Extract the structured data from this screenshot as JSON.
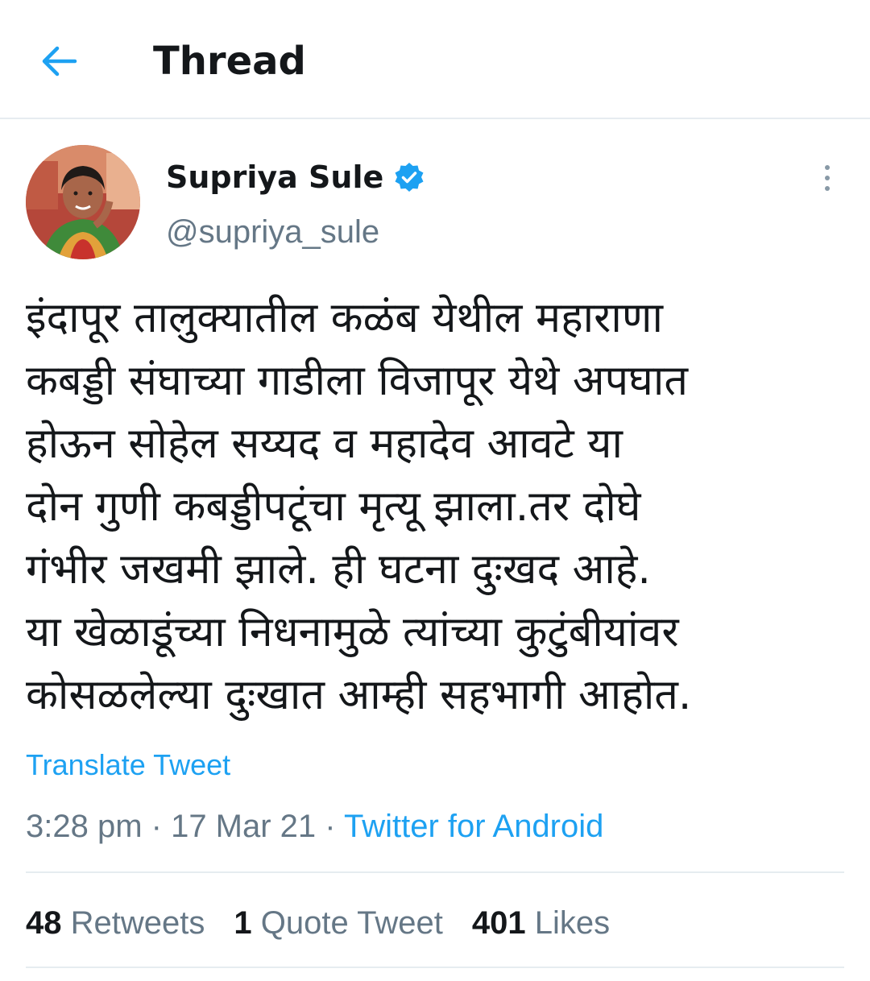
{
  "header": {
    "title": "Thread"
  },
  "author": {
    "name": "Supriya Sule",
    "handle": "@supriya_sule",
    "verified": true
  },
  "tweet": {
    "lines": [
      "इंदापूर तालुक्यातील कळंब येथील महाराणा",
      "कबड्डी संघाच्या गाडीला विजापूर येथे अपघात",
      "होऊन सोहेल सय्यद व महादेव आवटे या",
      "दोन गुणी कबड्डीपटूंचा मृत्यू झाला.तर दोघे",
      "गंभीर जखमी झाले. ही घटना  दुःखद आहे.",
      "या खेळाडूंच्या निधनामुळे त्यांच्या कुटुंबीयांवर",
      "कोसळलेल्या दुःखात आम्ही सहभागी आहोत."
    ],
    "translate_label": "Translate Tweet",
    "time": "3:28 pm",
    "date": "17 Mar 21",
    "separator": " · ",
    "source": "Twitter for Android"
  },
  "stats": {
    "retweets": {
      "count": "48",
      "label": "Retweets"
    },
    "quotes": {
      "count": "1",
      "label": "Quote Tweet"
    },
    "likes": {
      "count": "401",
      "label": "Likes"
    }
  },
  "colors": {
    "accent": "#1da1f2",
    "secondary_text": "#657786",
    "divider": "#e6ecf0"
  },
  "icons": {
    "back": "arrow-left-icon",
    "verified": "verified-badge-icon",
    "more": "more-vertical-icon"
  }
}
